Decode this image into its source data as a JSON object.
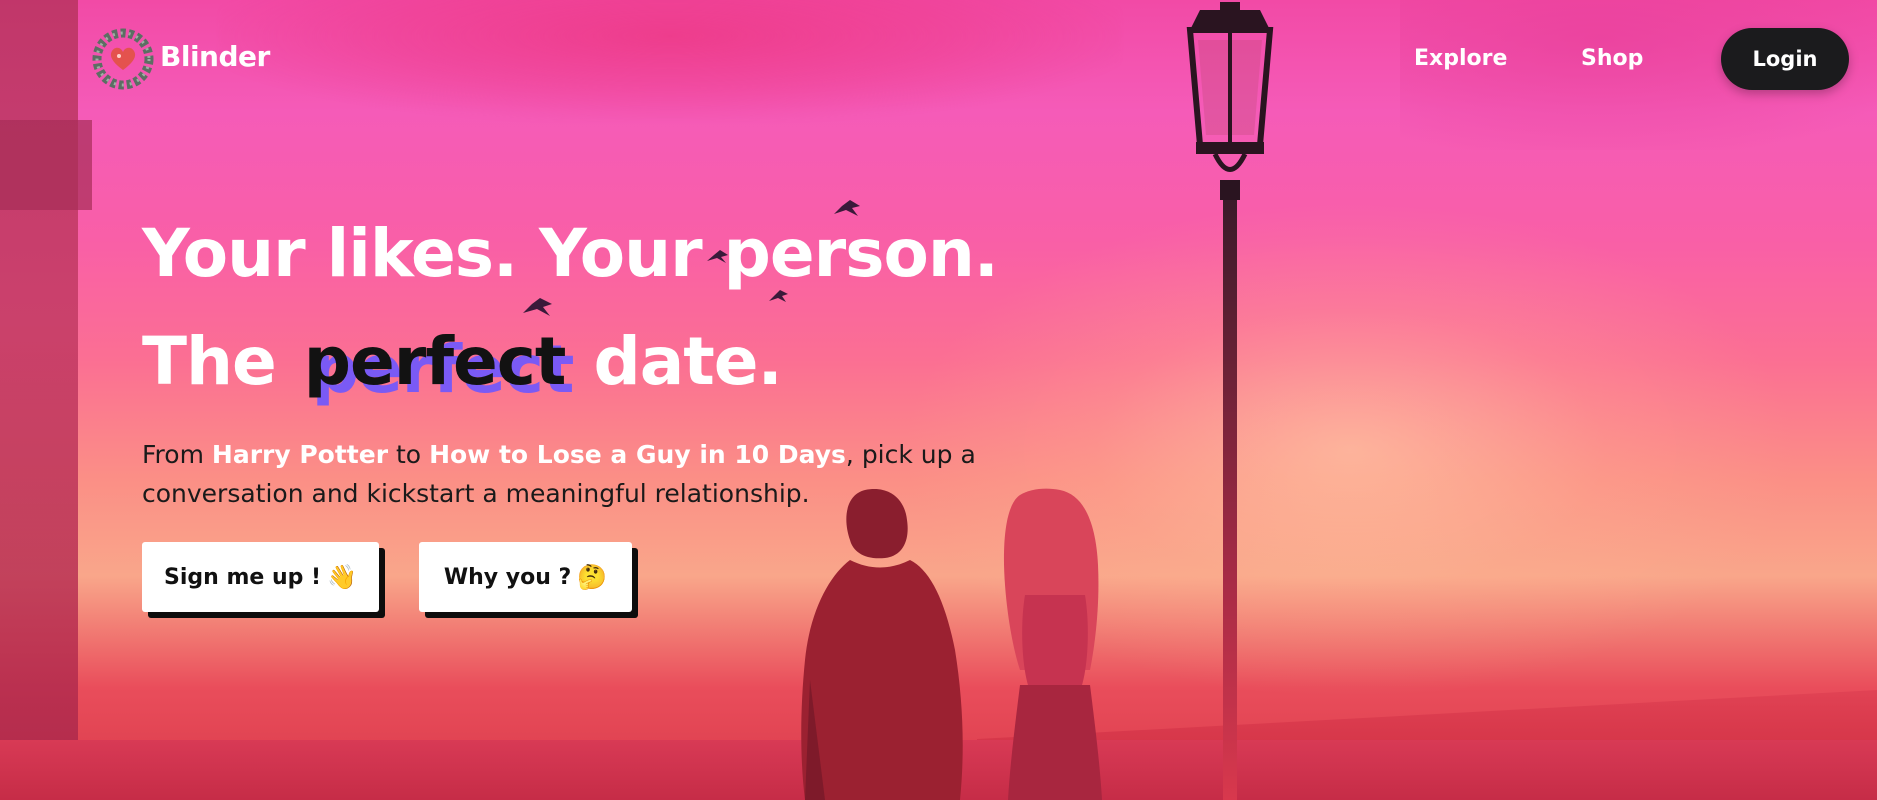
{
  "header": {
    "brand": "Blinder",
    "nav": [
      {
        "label": "Explore"
      },
      {
        "label": "Shop"
      }
    ],
    "login_label": "Login"
  },
  "hero": {
    "line1": "Your likes. Your person.",
    "line2_prefix": "The",
    "line2_highlight": "perfect",
    "line2_suffix": "date.",
    "sub_from": "From",
    "sub_title1": "Harry Potter",
    "sub_to": "to",
    "sub_title2": "How to Lose a Guy in 10 Days",
    "sub_rest": ", pick up a conversation and kickstart a meaningful relationship.",
    "signup_label": "Sign me up !",
    "signup_emoji": "👋",
    "why_label": "Why you ?",
    "why_emoji": "🤔"
  },
  "colors": {
    "accent": "#7a5af5",
    "login_bg": "#1b1b1d",
    "sky_top": "#f24aa6",
    "sky_bottom": "#f9a68a"
  },
  "icons": {
    "logo": "heart-wreath-logo-icon"
  }
}
